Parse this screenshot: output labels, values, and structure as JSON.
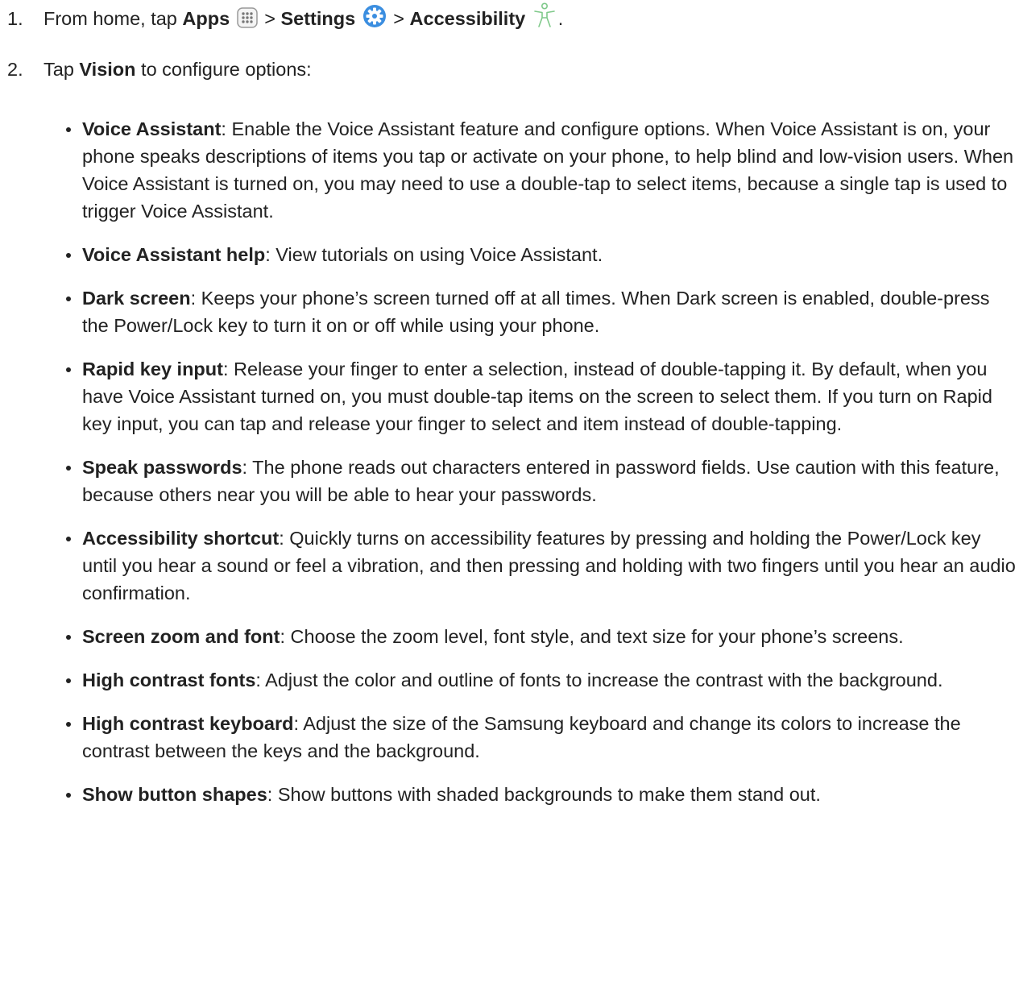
{
  "steps": [
    {
      "number": "1.",
      "from_home": "From home, tap ",
      "apps": "Apps",
      "sep1": " > ",
      "settings": "Settings",
      "sep2": " > ",
      "accessibility": "Accessibility",
      "end": "."
    },
    {
      "number": "2.",
      "tap": "Tap ",
      "vision": "Vision",
      "rest": " to configure options:"
    }
  ],
  "icons": {
    "apps": "apps-grid-icon",
    "settings": "settings-gear-icon",
    "accessibility": "accessibility-person-icon"
  },
  "colors": {
    "apps_icon": "#8a8a8a",
    "settings_icon": "#3b8ee0",
    "accessibility_icon": "#7fc98a"
  },
  "options": [
    {
      "term": "Voice Assistant",
      "desc": ": Enable the Voice Assistant feature and configure options. When Voice Assistant is on, your phone speaks descriptions of items you tap or activate on your phone, to help blind and low-vision users. When Voice Assistant is turned on, you may need to use a double-tap to select items, because a single tap is used to trigger Voice Assistant."
    },
    {
      "term": "Voice Assistant help",
      "desc": ": View tutorials on using Voice Assistant."
    },
    {
      "term": "Dark screen",
      "desc": ": Keeps your phone’s screen turned off at all times. When Dark screen is enabled, double-press the Power/Lock key to turn it on or off while using your phone."
    },
    {
      "term": "Rapid key input",
      "desc": ": Release your finger to enter a selection, instead of double-tapping it. By default, when you have Voice Assistant turned on, you must double-tap items on the screen to select them. If you turn on Rapid key input, you can tap and release your finger to select and item instead of double-tapping."
    },
    {
      "term": "Speak passwords",
      "desc": ": The phone reads out characters entered in password fields. Use caution with this feature, because others near you will be able to hear your passwords."
    },
    {
      "term": "Accessibility shortcut",
      "desc": ": Quickly turns on accessibility features by pressing and holding the Power/Lock key until you hear a sound or feel a vibration, and then pressing and holding with two fingers until you hear an audio confirmation."
    },
    {
      "term": "Screen zoom and font",
      "desc": ": Choose the zoom level, font style, and text size for your phone’s screens."
    },
    {
      "term": "High contrast fonts",
      "desc": ": Adjust the color and outline of fonts to increase the contrast with the background."
    },
    {
      "term": "High contrast keyboard",
      "desc": ": Adjust the size of the Samsung keyboard and change its colors to increase the contrast between the keys and the background."
    },
    {
      "term": "Show button shapes",
      "desc": ": Show buttons with shaded backgrounds to make them stand out."
    }
  ]
}
